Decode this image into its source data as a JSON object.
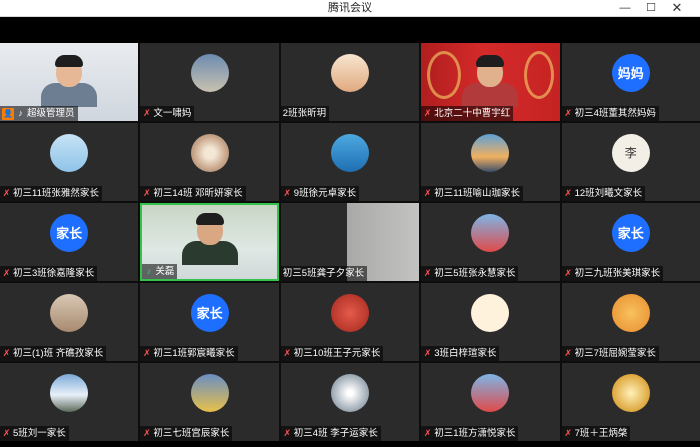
{
  "window": {
    "title": "腾讯会议",
    "controls": {
      "minimize": "—",
      "maximize": "☐",
      "close": "✕"
    }
  },
  "grid": {
    "tiles": [
      {
        "name": "超级管理员",
        "type": "video",
        "host": true,
        "mic": "active"
      },
      {
        "name": "文一啸妈",
        "type": "avatar",
        "avatar_style": "house",
        "mic": "muted"
      },
      {
        "name": "2班张昕玥",
        "type": "avatar",
        "avatar_style": "kids",
        "mic": "none"
      },
      {
        "name": "北京二十中曹宇红",
        "type": "video",
        "mic": "muted"
      },
      {
        "name": "初三4班董其然妈妈",
        "type": "avatar",
        "avatar_style": "blue",
        "avatar_text": "妈妈",
        "mic": "muted"
      },
      {
        "name": "初三11班张雅然家长",
        "type": "avatar",
        "avatar_style": "sky",
        "mic": "muted"
      },
      {
        "name": "初三14班 邓昕妍家长",
        "type": "avatar",
        "avatar_style": "flower",
        "mic": "muted"
      },
      {
        "name": "9班徐元卓家长",
        "type": "avatar",
        "avatar_style": "dolphin",
        "mic": "muted"
      },
      {
        "name": "初三11班喻山珈家长",
        "type": "avatar",
        "avatar_style": "sunset",
        "mic": "muted"
      },
      {
        "name": "12班刘曦文家长",
        "type": "avatar",
        "avatar_style": "calli",
        "avatar_text": "李",
        "mic": "muted"
      },
      {
        "name": "初三3班徐嘉隆家长",
        "type": "avatar",
        "avatar_style": "blue",
        "avatar_text": "家长",
        "mic": "muted"
      },
      {
        "name": "关磊",
        "type": "video",
        "mic": "speaking"
      },
      {
        "name": "初三5班龚子夕家长",
        "type": "video",
        "mic": "none"
      },
      {
        "name": "初三5班张永慧家长",
        "type": "avatar",
        "avatar_style": "dance",
        "mic": "muted"
      },
      {
        "name": "初三九班张美琪家长",
        "type": "avatar",
        "avatar_style": "blue",
        "avatar_text": "家长",
        "mic": "muted"
      },
      {
        "name": "初三(1)班 齐礁孜家长",
        "type": "avatar",
        "avatar_style": "cat",
        "mic": "muted"
      },
      {
        "name": "初三1班郭宸曦家长",
        "type": "avatar",
        "avatar_style": "blue",
        "avatar_text": "家长",
        "mic": "muted"
      },
      {
        "name": "初三10班王子元家长",
        "type": "avatar",
        "avatar_style": "red",
        "mic": "muted"
      },
      {
        "name": "3班白梓瑄家长",
        "type": "avatar",
        "avatar_style": "girl",
        "mic": "muted"
      },
      {
        "name": "初三7班屈婉莹家长",
        "type": "avatar",
        "avatar_style": "persimmon",
        "mic": "muted"
      },
      {
        "name": "5班刘一家长",
        "type": "avatar",
        "avatar_style": "mountain",
        "mic": "muted"
      },
      {
        "name": "初三七班宫辰家长",
        "type": "avatar",
        "avatar_style": "yellow",
        "mic": "muted"
      },
      {
        "name": "初三4班 李子运家长",
        "type": "avatar",
        "avatar_style": "spiral",
        "mic": "muted"
      },
      {
        "name": "初三1班方潇悦家长",
        "type": "avatar",
        "avatar_style": "dance",
        "mic": "muted"
      },
      {
        "name": "7班＋王炳棨",
        "type": "avatar",
        "avatar_style": "gold",
        "mic": "muted"
      }
    ]
  },
  "colors": {
    "tile_bg": "#2b2b2b",
    "avatar_blue": "#1e6fff",
    "host_badge": "#ff7a00",
    "speaking_border": "#35c24a",
    "muted_icon": "#ff5252"
  }
}
